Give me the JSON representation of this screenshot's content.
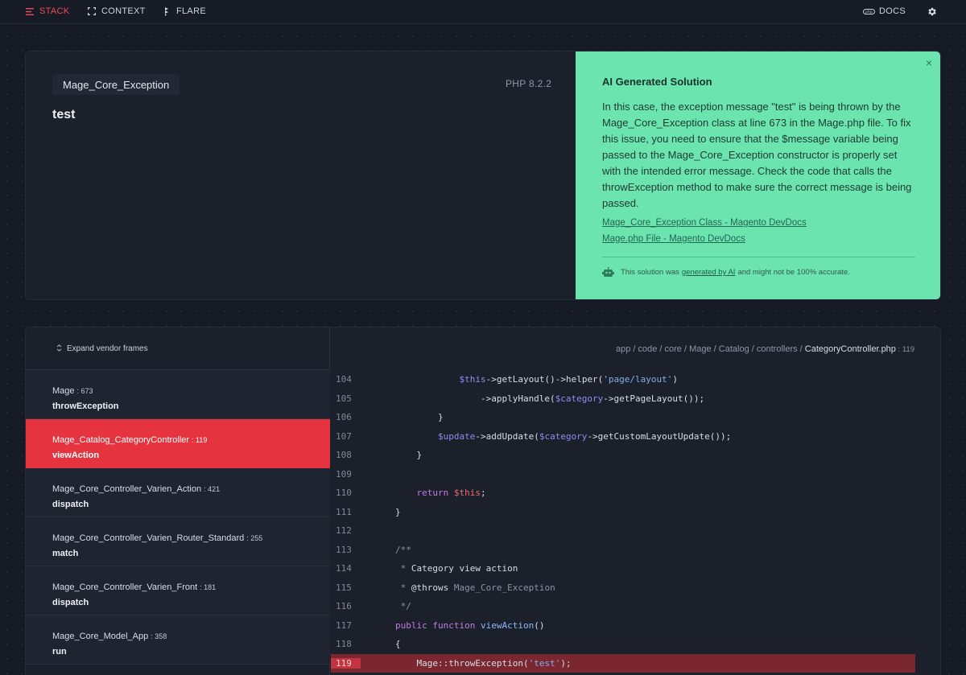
{
  "nav": {
    "stack": "STACK",
    "context": "CONTEXT",
    "flare": "FLARE",
    "docs": "DOCS"
  },
  "error": {
    "exception_class": "Mage_Core_Exception",
    "php_version": "PHP 8.2.2",
    "message": "test"
  },
  "solution": {
    "title": "AI Generated Solution",
    "text": "In this case, the exception message \"test\" is being thrown by the Mage_Core_Exception class at line 673 in the Mage.php file. To fix this issue, you need to ensure that the $message variable being passed to the Mage_Core_Exception constructor is properly set with the intended error message. Check the code that calls the throwException method to make sure the correct message is being passed.",
    "links": [
      "Mage_Core_Exception Class - Magento DevDocs",
      "Mage.php File - Magento DevDocs"
    ],
    "footer_prefix": "This solution was",
    "footer_link": "generated by AI",
    "footer_suffix": "and might not be 100% accurate.",
    "close": "×"
  },
  "stack": {
    "expand_label": "Expand vendor frames",
    "frames": [
      {
        "class": "Mage",
        "line": "673",
        "function": "throwException"
      },
      {
        "class": "Mage_Catalog_CategoryController",
        "line": "119",
        "function": "viewAction"
      },
      {
        "class": "Mage_Core_Controller_Varien_Action",
        "line": "421",
        "function": "dispatch"
      },
      {
        "class": "Mage_Core_Controller_Varien_Router_Standard",
        "line": "255",
        "function": "match"
      },
      {
        "class": "Mage_Core_Controller_Varien_Front",
        "line": "181",
        "function": "dispatch"
      },
      {
        "class": "Mage_Core_Model_App",
        "line": "358",
        "function": "run"
      }
    ],
    "selected_frame": 1
  },
  "file": {
    "path_segments": [
      "app",
      "code",
      "core",
      "Mage",
      "Catalog",
      "controllers"
    ],
    "filename": "CategoryController.php",
    "line": "119"
  },
  "code": {
    "highlight_line": "119",
    "lines": [
      {
        "n": "104",
        "text": "            $this->getLayout()->helper('page/layout')"
      },
      {
        "n": "105",
        "text": "                ->applyHandle($category->getPageLayout());"
      },
      {
        "n": "106",
        "text": "        }"
      },
      {
        "n": "107",
        "text": "        $update->addUpdate($category->getCustomLayoutUpdate());"
      },
      {
        "n": "108",
        "text": "    }"
      },
      {
        "n": "109",
        "text": ""
      },
      {
        "n": "110",
        "text": "    return $this;"
      },
      {
        "n": "111",
        "text": "}"
      },
      {
        "n": "112",
        "text": ""
      },
      {
        "n": "113",
        "text": "/**"
      },
      {
        "n": "114",
        "text": " * Category view action"
      },
      {
        "n": "115",
        "text": " * @throws Mage_Core_Exception"
      },
      {
        "n": "116",
        "text": " */"
      },
      {
        "n": "117",
        "text": "public function viewAction()"
      },
      {
        "n": "118",
        "text": "{"
      },
      {
        "n": "119",
        "text": "    Mage::throwException('test');"
      }
    ]
  },
  "colors": {
    "accent": "#e5343f",
    "solution_bg": "#6be4b0",
    "background": "#151a24"
  }
}
